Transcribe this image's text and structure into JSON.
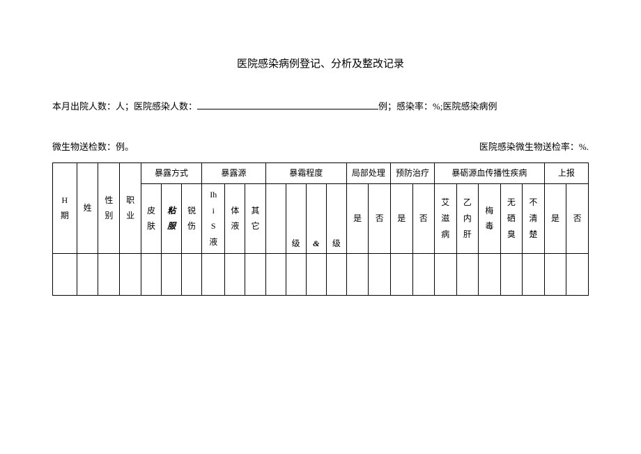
{
  "title": "医院感染病例登记、分析及整改记录",
  "line1_prefix": "本月出院人数：人；医院感染人数：",
  "line1_suffix": "例；感染率：%;医院感染病例",
  "line2_left": "微生物送检数：例。",
  "line2_right": "医院感染微生物送检率：%.",
  "groups": {
    "exposure_method": "暴露方式",
    "exposure_source": "暴露源",
    "exposure_degree": "暴霜程度",
    "local_treatment": "局部处理",
    "prevention": "预防治疗",
    "blood_disease": "暴砺源血传播性疾病",
    "report": "上报"
  },
  "cols": {
    "h_period": "H\n期",
    "name": "姓",
    "gender": "性\n别",
    "occupation": "职\n业",
    "skin": "皮\n肤",
    "mucosa": "粘\n服",
    "sharp_injury": "锐\n伤",
    "ihi_s_liquid": "Ihi\nS\n液",
    "body_fluid": "体\n液",
    "other": "其\n它",
    "level1_blank": "",
    "level1": "级",
    "amp": "&",
    "level2": "级",
    "yes": "是",
    "no": "否",
    "aids": "艾\n滋\n病",
    "hepb": "乙\n内\n肝",
    "syphilis": "梅\n毒",
    "no_blood": "无\n硒\n臭",
    "unclear": "不\n清\n楚"
  }
}
